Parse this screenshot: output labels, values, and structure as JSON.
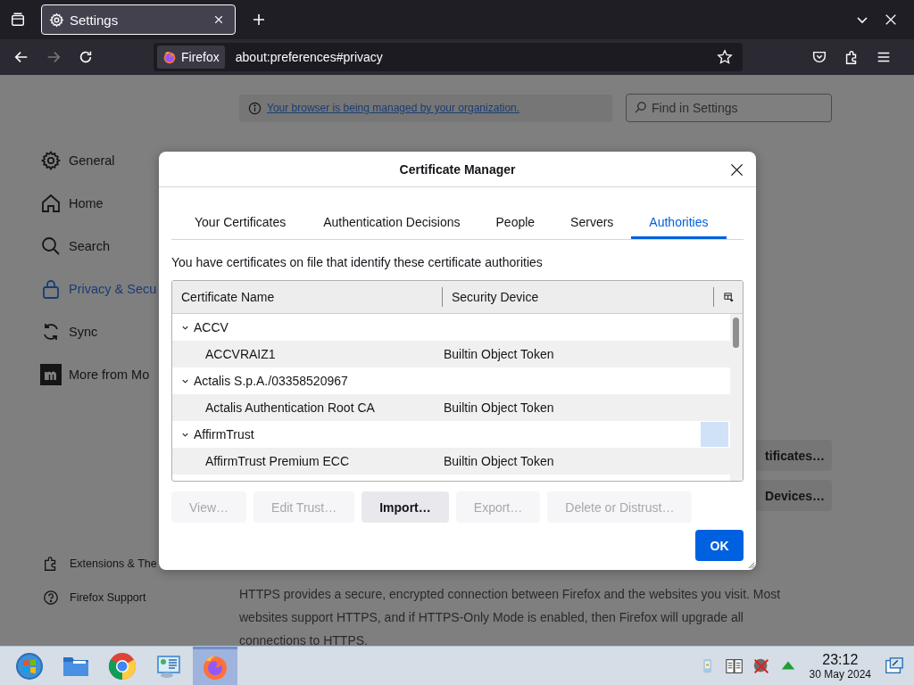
{
  "browser": {
    "tabs": [
      {
        "title": "Settings",
        "selected": true
      }
    ],
    "identity": "Firefox",
    "url": "about:preferences#privacy"
  },
  "page": {
    "banner": "Your browser is being managed by your organization.",
    "search": {
      "placeholder": "Find in Settings"
    },
    "sidebar": {
      "items": [
        {
          "label": "General",
          "kind": "gear",
          "selected": false
        },
        {
          "label": "Home",
          "kind": "home",
          "selected": false
        },
        {
          "label": "Search",
          "kind": "search",
          "selected": false
        },
        {
          "label": "Privacy & Secu",
          "kind": "lock",
          "selected": true
        },
        {
          "label": "Sync",
          "kind": "sync",
          "selected": false
        },
        {
          "label": "More from Mo",
          "kind": "mozilla",
          "selected": false
        }
      ],
      "footer": [
        {
          "label": "Extensions & The",
          "kind": "puzzle"
        },
        {
          "label": "Firefox Support",
          "kind": "help"
        }
      ]
    },
    "buttons": [
      "tificates…",
      "Devices…"
    ],
    "paragraph": "HTTPS provides a secure, encrypted connection between Firefox and the websites you visit. Most websites support HTTPS, and if HTTPS-Only Mode is enabled, then Firefox will upgrade all connections to HTTPS."
  },
  "dialog": {
    "title": "Certificate Manager",
    "tabs": [
      {
        "label": "Your Certificates",
        "selected": false
      },
      {
        "label": "Authentication Decisions",
        "selected": false
      },
      {
        "label": "People",
        "selected": false
      },
      {
        "label": "Servers",
        "selected": false
      },
      {
        "label": "Authorities",
        "selected": true
      }
    ],
    "description": "You have certificates on file that identify these certificate authorities",
    "table": {
      "columns": [
        "Certificate Name",
        "Security Device"
      ],
      "groups": [
        {
          "name": "ACCV",
          "expanded": true,
          "children": [
            {
              "name": "ACCVRAIZ1",
              "device": "Builtin Object Token"
            }
          ]
        },
        {
          "name": "Actalis S.p.A./03358520967",
          "expanded": true,
          "children": [
            {
              "name": "Actalis Authentication Root CA",
              "device": "Builtin Object Token"
            }
          ]
        },
        {
          "name": "AffirmTrust",
          "expanded": true,
          "children": [
            {
              "name": "AffirmTrust Premium ECC",
              "device": "Builtin Object Token"
            }
          ]
        }
      ]
    },
    "buttons": [
      {
        "label": "View…",
        "disabled": true
      },
      {
        "label": "Edit Trust…",
        "disabled": true
      },
      {
        "label": "Import…",
        "disabled": false
      },
      {
        "label": "Export…",
        "disabled": true
      },
      {
        "label": "Delete or Distrust…",
        "disabled": true
      }
    ],
    "ok": "OK"
  },
  "taskbar": {
    "apps": [
      {
        "kind": "start",
        "active": false
      },
      {
        "kind": "folder",
        "active": false
      },
      {
        "kind": "chrome",
        "active": false
      },
      {
        "kind": "panel",
        "active": false
      },
      {
        "kind": "firefox",
        "active": true
      }
    ],
    "tray": [
      {
        "kind": "phone"
      },
      {
        "kind": "notes"
      },
      {
        "kind": "network"
      },
      {
        "kind": "arrow"
      }
    ],
    "time": "23:12",
    "date": "30 May 2024"
  }
}
